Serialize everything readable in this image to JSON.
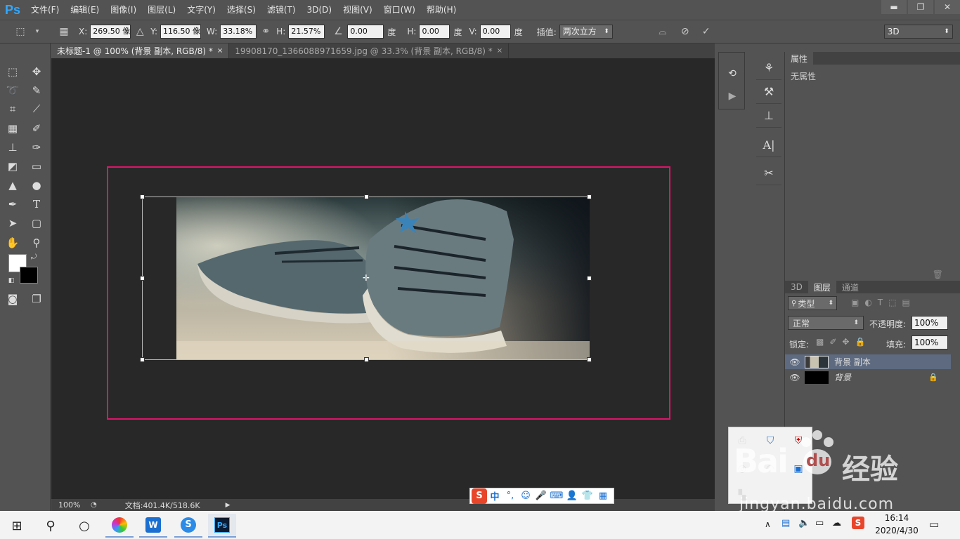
{
  "app": {
    "logo": "Ps"
  },
  "menu": [
    "文件(F)",
    "编辑(E)",
    "图像(I)",
    "图层(L)",
    "文字(Y)",
    "选择(S)",
    "滤镜(T)",
    "3D(D)",
    "视图(V)",
    "窗口(W)",
    "帮助(H)"
  ],
  "window_controls": {
    "minimize": "▬",
    "restore": "❐",
    "close": "✕"
  },
  "options": {
    "x_label": "X:",
    "x_value": "269.50 像",
    "y_label": "Y:",
    "y_value": "116.50 像",
    "w_label": "W:",
    "w_value": "33.18%",
    "h_label": "H:",
    "h_value": "21.57%",
    "angle_value": "0.00",
    "angle_unit": "度",
    "hskew_label": "H:",
    "hskew_value": "0.00",
    "hskew_unit": "度",
    "vskew_label": "V:",
    "vskew_value": "0.00",
    "vskew_unit": "度",
    "interp_label": "插值:",
    "interp_value": "两次立方",
    "workspace": "3D"
  },
  "tabs": [
    {
      "label": "未标题-1 @ 100% (背景 副本, RGB/8) *",
      "close": "×",
      "active": true
    },
    {
      "label": "19908170_1366088971659.jpg @ 33.3% (背景 副本, RGB/8) *",
      "close": "×",
      "active": false
    }
  ],
  "status": {
    "zoom": "100%",
    "doc": "文档:401.4K/518.6K"
  },
  "properties": {
    "tab": "属性",
    "content": "无属性"
  },
  "layers": {
    "tabs": [
      "3D",
      "图层",
      "通道"
    ],
    "filter_label": "类型",
    "blend_mode": "正常",
    "opacity_label": "不透明度:",
    "opacity_value": "100%",
    "lock_label": "锁定:",
    "fill_label": "填充:",
    "fill_value": "100%",
    "rows": [
      {
        "name": "背景 副本",
        "selected": true
      },
      {
        "name": "背景",
        "selected": false
      }
    ]
  },
  "taskbar": {
    "time": "16:14",
    "date": "2020/4/30",
    "ime_lang": "中"
  },
  "colors": {
    "artboard_border": "#e0136b",
    "ps_blue": "#31a8ff",
    "canvas_bg": "#282828"
  },
  "watermark": {
    "brand": "Bai",
    "brand2": "du",
    "cn": "经验",
    "url": "jingyan.baidu.com"
  }
}
